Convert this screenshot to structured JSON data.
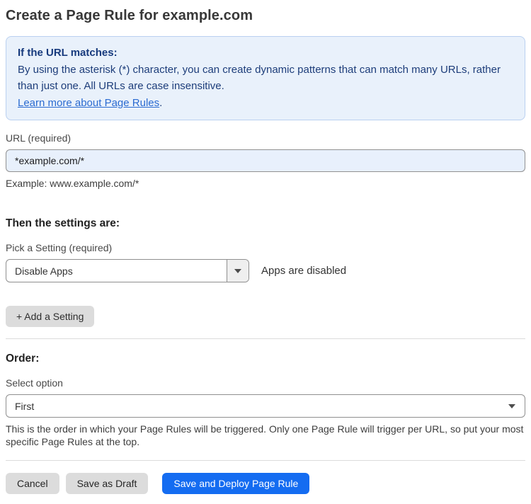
{
  "page": {
    "title": "Create a Page Rule for example.com"
  },
  "info_box": {
    "heading": "If the URL matches:",
    "body": "By using the asterisk (*) character, you can create dynamic patterns that can match many URLs, rather than just one. All URLs are case insensitive.",
    "link_label": "Learn more about Page Rules",
    "link_suffix": "."
  },
  "url_field": {
    "label": "URL (required)",
    "value": "*example.com/*",
    "helper": "Example: www.example.com/*"
  },
  "settings": {
    "heading": "Then the settings are:",
    "picker_label": "Pick a Setting (required)",
    "picker_value": "Disable Apps",
    "status_text": "Apps are disabled",
    "add_button_label": "+ Add a Setting"
  },
  "order": {
    "heading": "Order:",
    "select_label": "Select option",
    "select_value": "First",
    "helper": "This is the order in which your Page Rules will be triggered. Only one Page Rule will trigger per URL, so put your most specific Page Rules at the top."
  },
  "footer": {
    "cancel_label": "Cancel",
    "save_draft_label": "Save as Draft",
    "save_deploy_label": "Save and Deploy Page Rule"
  },
  "colors": {
    "primary_blue": "#146cf1",
    "info_background": "#e9f1fb",
    "info_border": "#bad0f0",
    "info_text": "#1d3d7a",
    "link_blue": "#2b6bd1",
    "url_input_background": "#e8f0fc",
    "gray_button": "#dcdcdc"
  }
}
